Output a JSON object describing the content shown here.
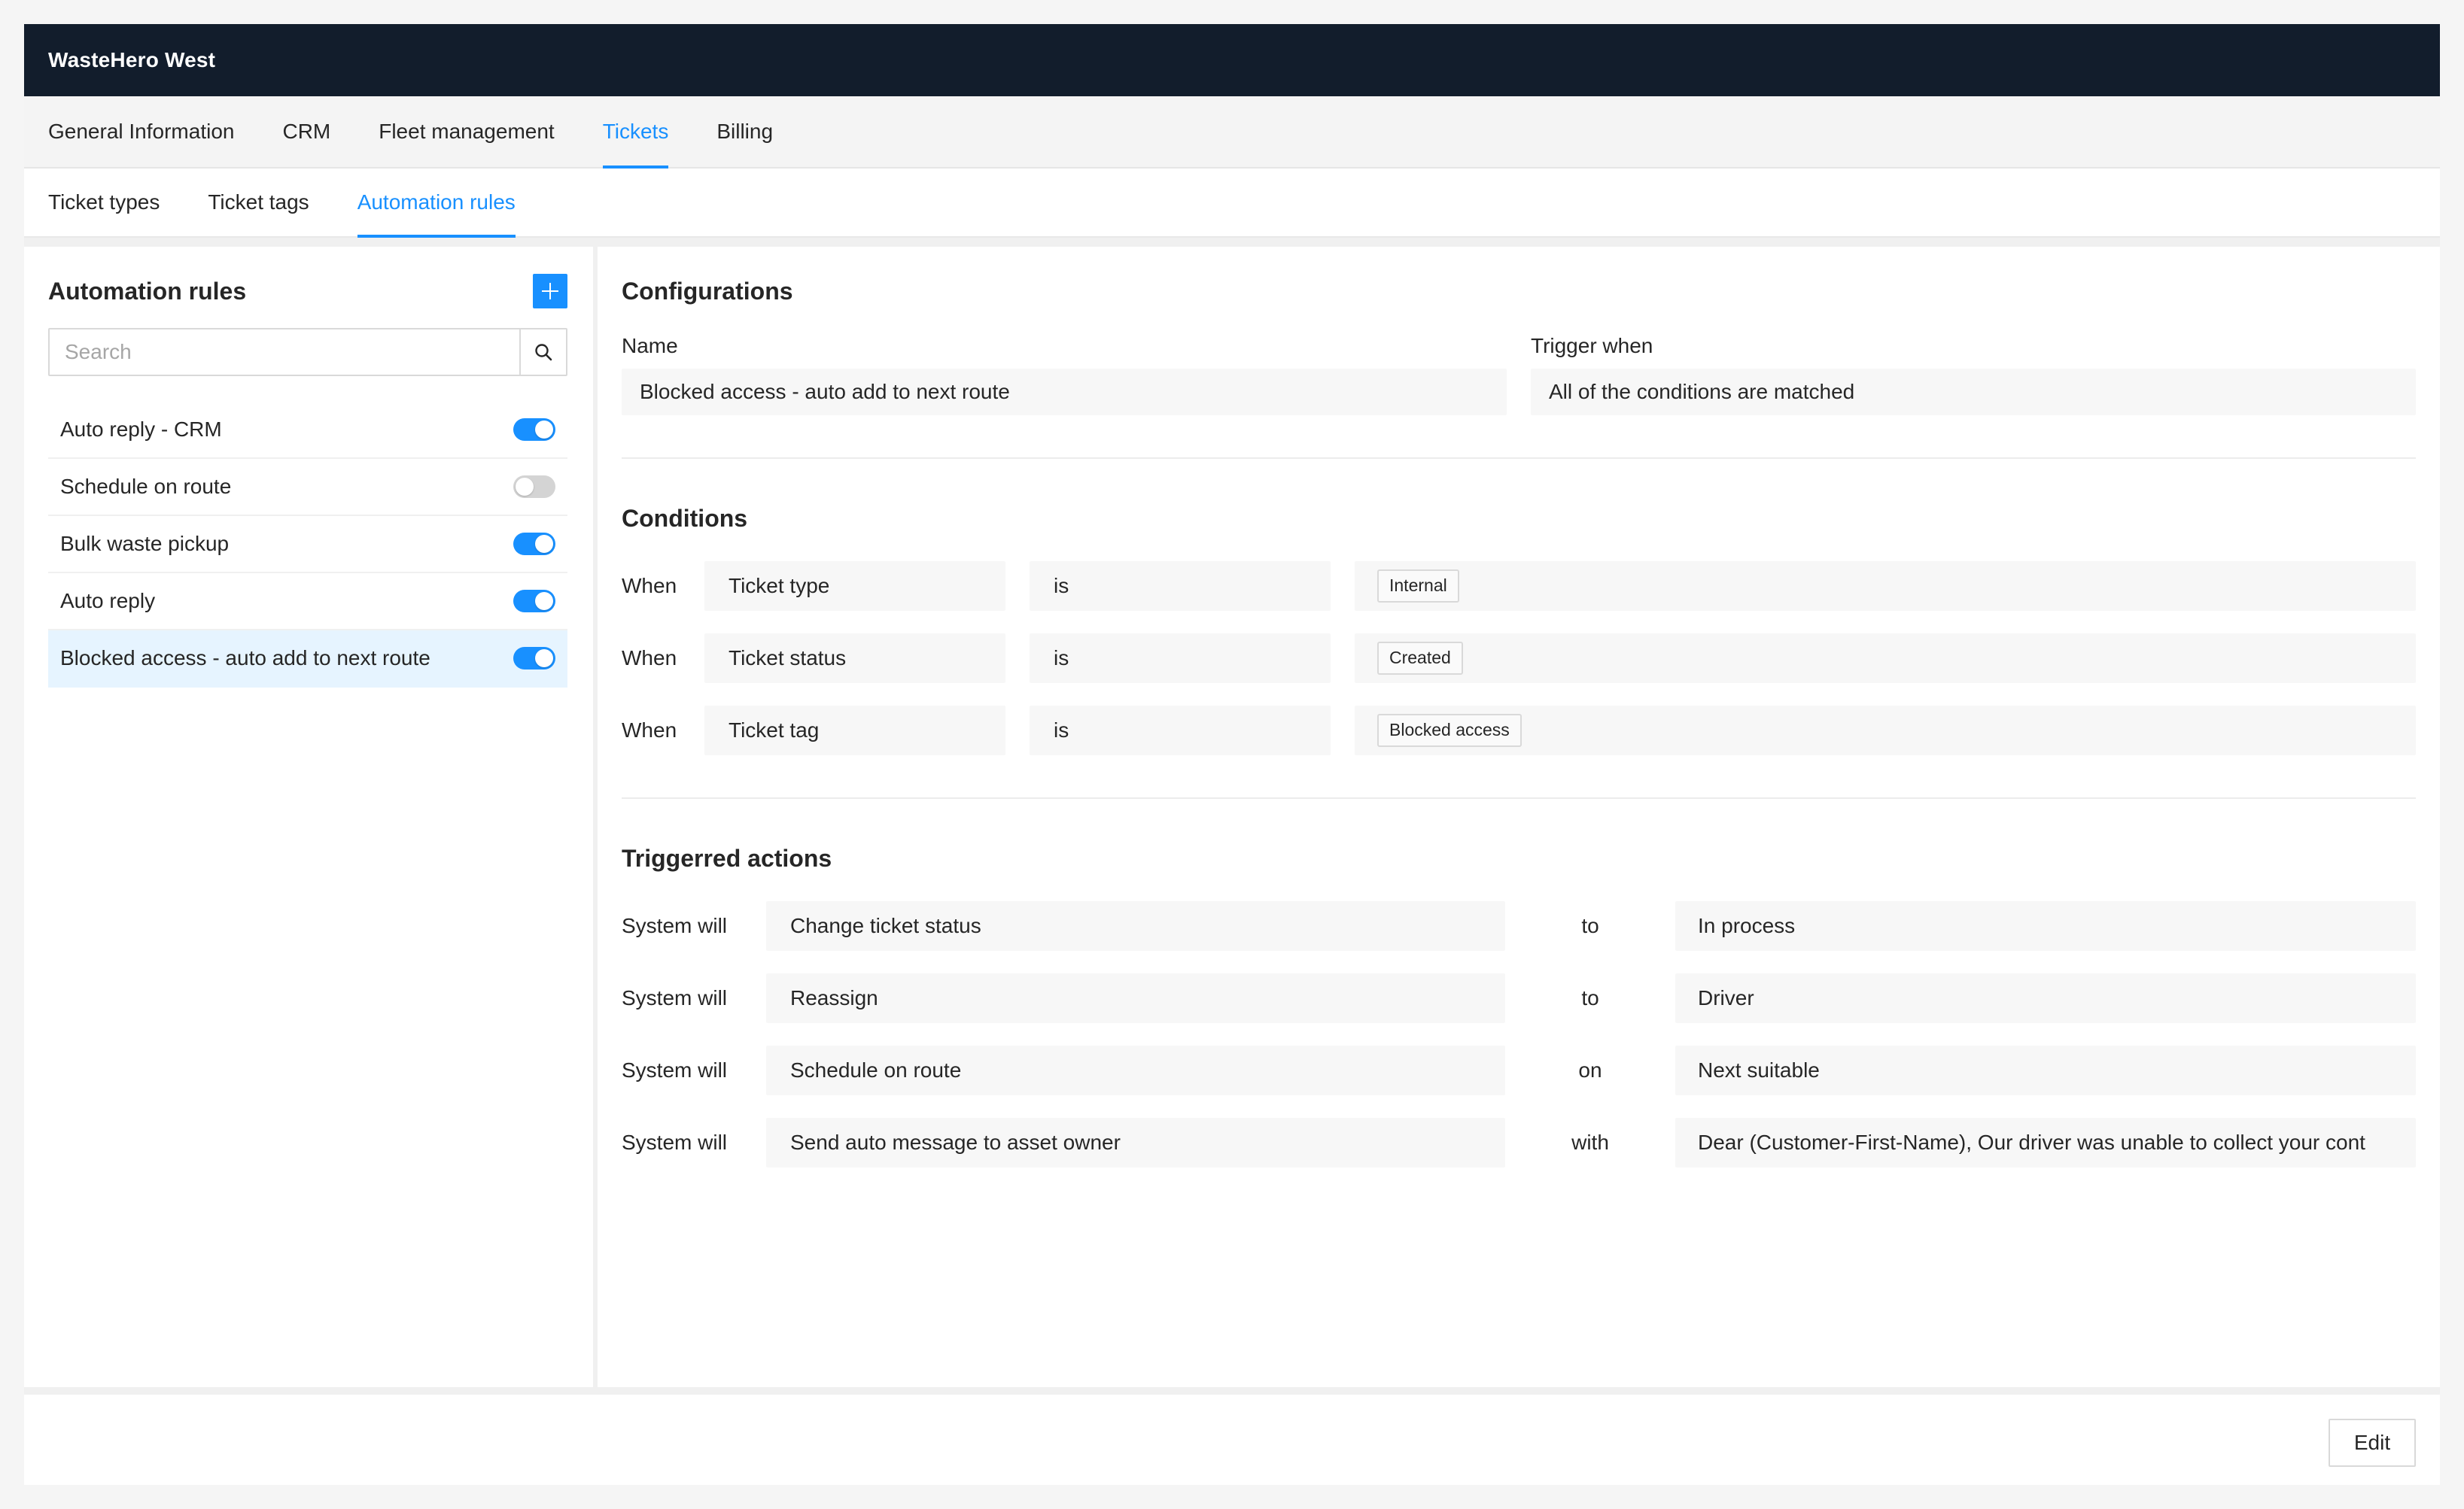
{
  "app": {
    "title": "WasteHero West"
  },
  "main_tabs": [
    {
      "label": "General Information",
      "active": false
    },
    {
      "label": "CRM",
      "active": false
    },
    {
      "label": "Fleet management",
      "active": false
    },
    {
      "label": "Tickets",
      "active": true
    },
    {
      "label": "Billing",
      "active": false
    }
  ],
  "sub_tabs": [
    {
      "label": "Ticket types",
      "active": false
    },
    {
      "label": "Ticket tags",
      "active": false
    },
    {
      "label": "Automation rules",
      "active": true
    }
  ],
  "sidebar": {
    "title": "Automation rules",
    "add_icon": "plus-icon",
    "search": {
      "placeholder": "Search",
      "value": "",
      "icon": "search-icon"
    },
    "rules": [
      {
        "label": "Auto reply - CRM",
        "enabled": true,
        "selected": false
      },
      {
        "label": "Schedule on route",
        "enabled": false,
        "selected": false
      },
      {
        "label": "Bulk waste pickup",
        "enabled": true,
        "selected": false
      },
      {
        "label": "Auto reply",
        "enabled": true,
        "selected": false
      },
      {
        "label": "Blocked access - auto add to next route",
        "enabled": true,
        "selected": true
      }
    ]
  },
  "configurations": {
    "title": "Configurations",
    "name_label": "Name",
    "name_value": "Blocked access - auto add to next route",
    "trigger_label": "Trigger when",
    "trigger_value": "All of the conditions are matched"
  },
  "conditions": {
    "title": "Conditions",
    "rows": [
      {
        "when": "When",
        "field": "Ticket type",
        "operator": "is",
        "value": "Internal"
      },
      {
        "when": "When",
        "field": "Ticket status",
        "operator": "is",
        "value": "Created"
      },
      {
        "when": "When",
        "field": "Ticket tag",
        "operator": "is",
        "value": "Blocked access"
      }
    ]
  },
  "actions": {
    "title": "Triggerred actions",
    "rows": [
      {
        "label": "System will",
        "action": "Change ticket status",
        "preposition": "to",
        "value": "In process"
      },
      {
        "label": "System will",
        "action": "Reassign",
        "preposition": "to",
        "value": "Driver"
      },
      {
        "label": "System will",
        "action": "Schedule on route",
        "preposition": "on",
        "value": "Next suitable"
      },
      {
        "label": "System will",
        "action": "Send auto message to asset owner",
        "preposition": "with",
        "value": "Dear (Customer-First-Name), Our driver was unable to collect your cont"
      }
    ]
  },
  "footer": {
    "edit_label": "Edit"
  },
  "colors": {
    "topbar": "#121d2c",
    "accent": "#1890ff",
    "toggle_off": "#d4d4d4",
    "selected_row": "#e6f4ff"
  }
}
